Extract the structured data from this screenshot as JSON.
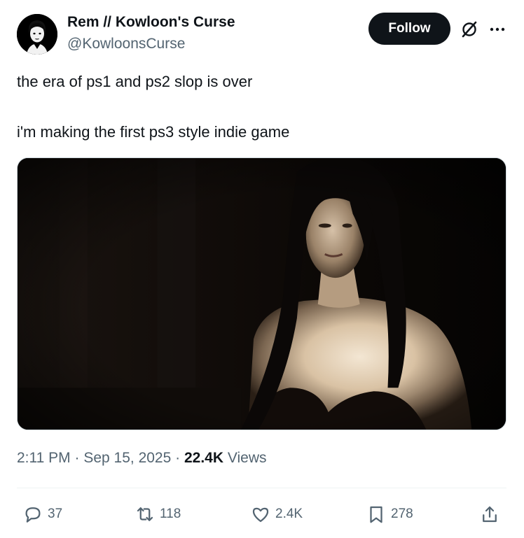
{
  "author": {
    "display_name": "Rem // Kowloon's Curse",
    "handle": "@KowloonsCurse",
    "avatar_icon": "avatar-face-icon"
  },
  "header": {
    "follow_label": "Follow",
    "grok_icon": "grok-icon",
    "more_icon": "more-icon"
  },
  "tweet": {
    "lines": [
      "the era of ps1 and ps2 slop is over",
      "i'm making the first ps3 style indie game"
    ],
    "media_description_icon": "game-screenshot-image"
  },
  "meta": {
    "time": "2:11 PM",
    "separator": "·",
    "date": "Sep 15, 2025",
    "views_count": "22.4K",
    "views_label": "Views"
  },
  "actions": {
    "reply": {
      "icon": "reply-icon",
      "count": "37"
    },
    "retweet": {
      "icon": "retweet-icon",
      "count": "118"
    },
    "like": {
      "icon": "heart-icon",
      "count": "2.4K"
    },
    "bookmark": {
      "icon": "bookmark-icon",
      "count": "278"
    },
    "share": {
      "icon": "share-icon"
    }
  },
  "colors": {
    "text_primary": "#0f1419",
    "text_secondary": "#536471",
    "follow_bg": "#0f1419",
    "divider": "#eff3f4"
  }
}
